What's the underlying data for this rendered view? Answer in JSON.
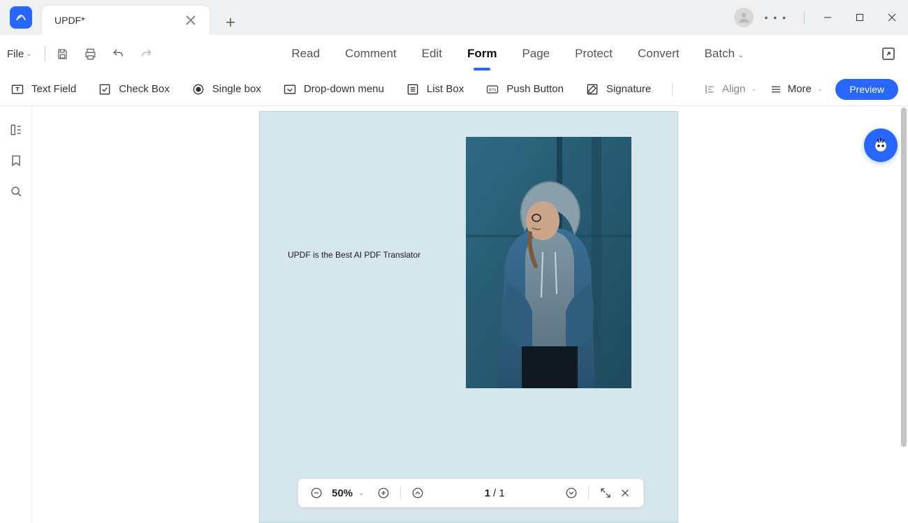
{
  "titlebar": {
    "tab_title": "UPDF*",
    "more_dots": "• • •"
  },
  "menubar": {
    "file_label": "File",
    "tabs": {
      "read": "Read",
      "comment": "Comment",
      "edit": "Edit",
      "form": "Form",
      "page": "Page",
      "protect": "Protect",
      "convert": "Convert",
      "batch": "Batch"
    }
  },
  "toolbar": {
    "text_field": "Text Field",
    "check_box": "Check Box",
    "single_box": "Single box",
    "dropdown": "Drop-down menu",
    "list_box": "List Box",
    "push_button": "Push Button",
    "signature": "Signature",
    "align": "Align",
    "more": "More",
    "preview": "Preview"
  },
  "document": {
    "body_text": "UPDF is the Best AI PDF Translator"
  },
  "footer": {
    "zoom": "50%",
    "page_current": "1",
    "page_separator": "/ 1"
  }
}
